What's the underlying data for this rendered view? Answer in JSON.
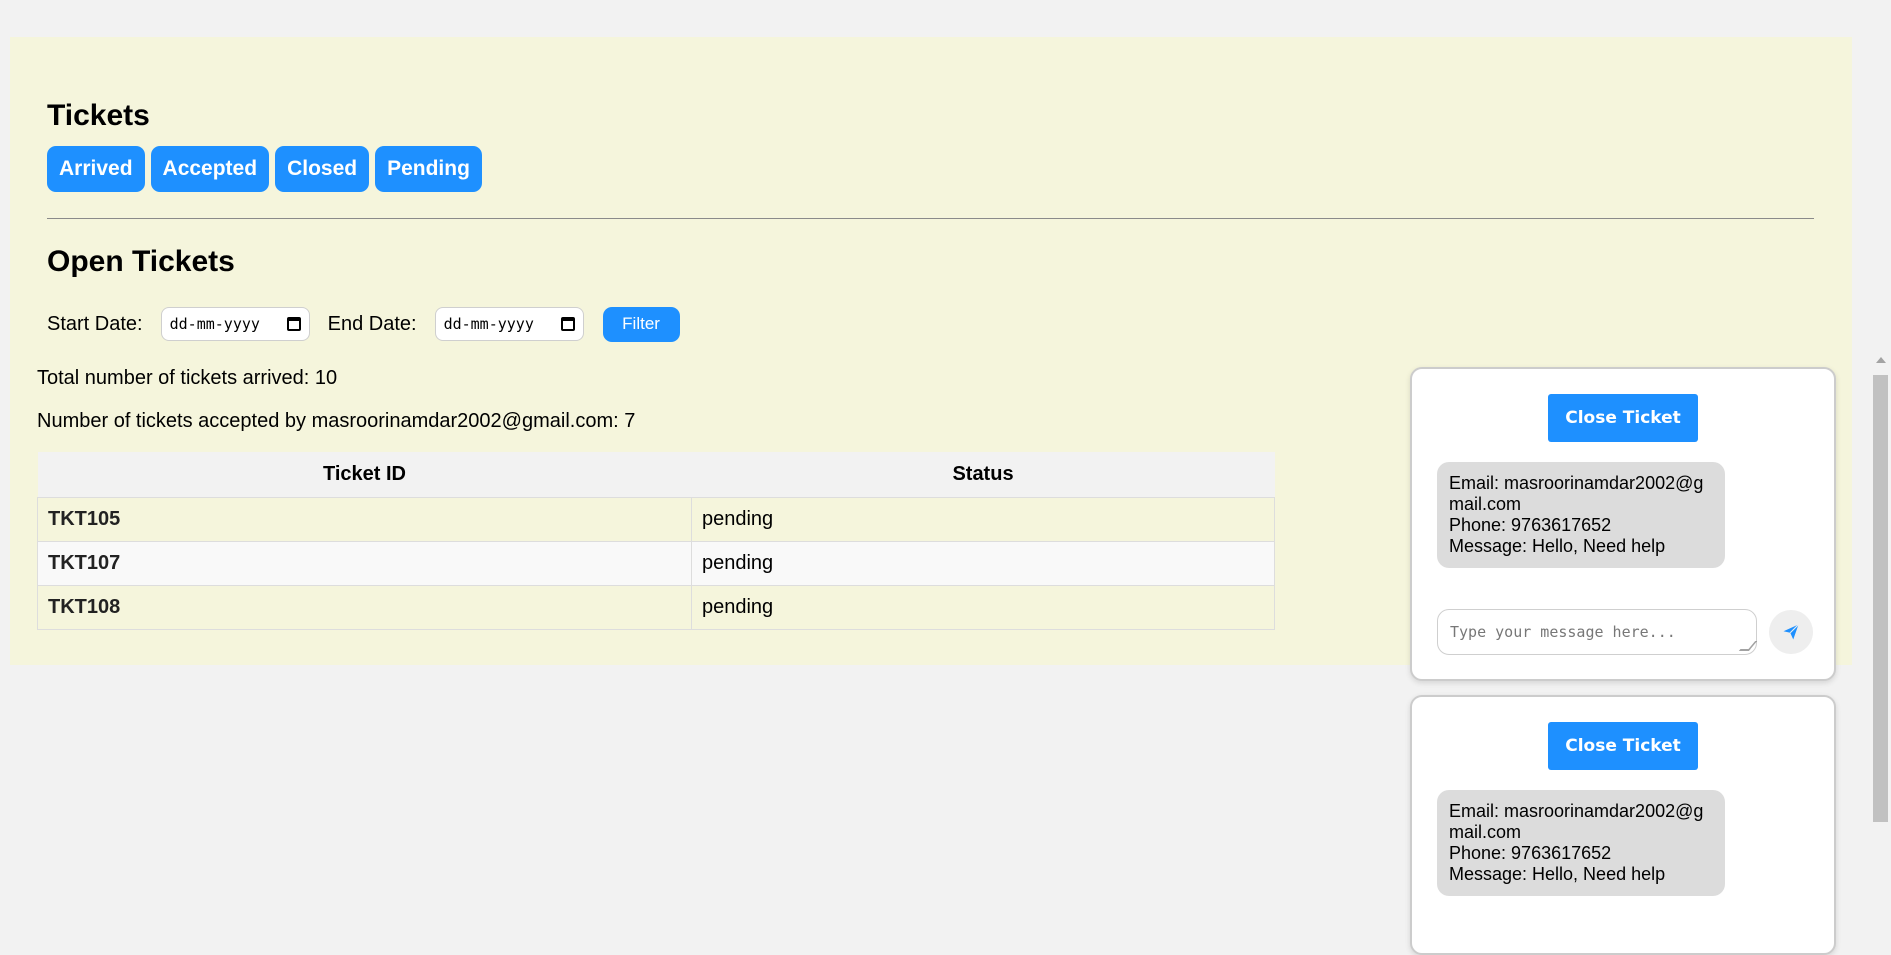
{
  "header": {
    "title": "Tickets",
    "tabs": [
      {
        "label": "Arrived"
      },
      {
        "label": "Accepted"
      },
      {
        "label": "Closed"
      },
      {
        "label": "Pending"
      }
    ]
  },
  "open_tickets": {
    "title": "Open Tickets",
    "start_date_label": "Start Date:",
    "end_date_label": "End Date:",
    "start_date_placeholder": "dd-mm-yyyy",
    "end_date_placeholder": "dd-mm-yyyy",
    "filter_label": "Filter",
    "total_arrived_text": "Total number of tickets arrived: 10",
    "accepted_text": "Number of tickets accepted by masroorinamdar2002@gmail.com: 7",
    "table": {
      "columns": [
        "Ticket ID",
        "Status"
      ],
      "rows": [
        {
          "id": "TKT105",
          "status": "pending"
        },
        {
          "id": "TKT107",
          "status": "pending"
        },
        {
          "id": "TKT108",
          "status": "pending"
        }
      ]
    }
  },
  "chats": [
    {
      "close_label": "Close Ticket",
      "email_line": "Email: masroorinamdar2002@gmail.com",
      "phone_line": "Phone: 9763617652",
      "message_line": "Message: Hello, Need help",
      "input_placeholder": "Type your message here..."
    },
    {
      "close_label": "Close Ticket",
      "email_line": "Email: masroorinamdar2002@gmail.com",
      "phone_line": "Phone: 9763617652",
      "message_line": "Message: Hello, Need help"
    }
  ],
  "colors": {
    "accent": "#1e90ff",
    "panel_background": "#f5f5dc",
    "page_background": "#f2f2f2"
  },
  "icons": {
    "send": "paper-plane-icon",
    "calendar": "calendar-icon"
  }
}
